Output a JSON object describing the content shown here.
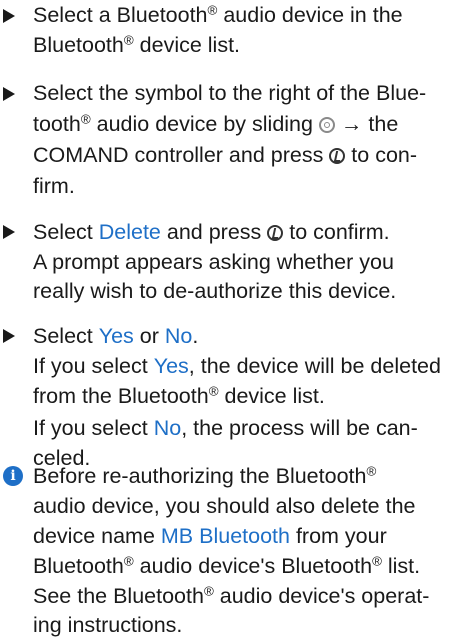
{
  "steps": [
    {
      "lines": [
        [
          "Select a Bluetooth",
          "®",
          " audio device in the"
        ],
        [
          "Bluetooth",
          "®",
          " device list."
        ]
      ]
    },
    {
      "lines": [
        [
          "Select the symbol to the right of the Blue-"
        ],
        [
          "tooth",
          "®",
          " audio device by sliding ",
          "controller-icon",
          " → the"
        ],
        [
          "COMAND controller and press ",
          "press-icon",
          " to con-"
        ],
        [
          "firm."
        ]
      ]
    },
    {
      "lines": [
        [
          "Select ",
          "Delete",
          " and press ",
          "press-icon",
          " to confirm."
        ],
        [
          "A prompt appears asking whether you"
        ],
        [
          "really wish to de-authorize this device."
        ]
      ]
    },
    {
      "lines": [
        [
          "Select ",
          "Yes",
          " or ",
          "No",
          "."
        ],
        [
          "If you select ",
          "Yes",
          ", the device will be deleted"
        ],
        [
          "from the Bluetooth",
          "®",
          " device list."
        ],
        [
          "If you select ",
          "No",
          ", the process will be can-"
        ],
        [
          "celed."
        ]
      ]
    }
  ],
  "note": {
    "lines": [
      [
        "Before re-authorizing the Bluetooth",
        "®"
      ],
      [
        "audio device, you should also delete the"
      ],
      [
        "device name ",
        "MB Bluetooth",
        " from your"
      ],
      [
        "Bluetooth",
        "®",
        " audio device's Bluetooth",
        "®",
        " list."
      ],
      [
        "See the Bluetooth",
        "®",
        " audio device's operat-"
      ],
      [
        "ing instructions."
      ]
    ]
  },
  "text": {
    "s1a": "Select a Bluetooth",
    "s1b": " audio device in the",
    "s1c": "Bluetooth",
    "s1d": " device list.",
    "s2a": "Select the symbol to the right of the Blue-",
    "s2b": "tooth",
    "s2c": " audio device by sliding ",
    "s2d": " → the",
    "s2e": "COMAND controller and press ",
    "s2f": " to con-",
    "s2g": "firm.",
    "s3a": "Select ",
    "s3b": "Delete",
    "s3c": " and press ",
    "s3d": " to confirm.",
    "s3e": "A prompt appears asking whether you",
    "s3f": "really wish to de-authorize this device.",
    "s4a": "Select ",
    "s4b": "Yes",
    "s4c": " or ",
    "s4d": "No",
    "s4e": ".",
    "s4f": "If you select ",
    "s4g": "Yes",
    "s4h": ", the device will be deleted",
    "s4i": "from the Bluetooth",
    "s4j": " device list.",
    "s4k": "If you select ",
    "s4l": "No",
    "s4m": ", the process will be can-",
    "s4n": "celed.",
    "n1": "Before re-authorizing the Bluetooth",
    "n2": "audio device, you should also delete the",
    "n3a": "device name ",
    "n3b": "MB Bluetooth",
    "n3c": " from your",
    "n4a": "Bluetooth",
    "n4b": " audio device's Bluetooth",
    "n4c": " list.",
    "n5a": "See the Bluetooth",
    "n5b": " audio device's operat-",
    "n6": "ing instructions.",
    "reg": "®",
    "info_glyph": "i"
  },
  "colors": {
    "accent": "#1e6fc7",
    "text": "#1a1a1a"
  },
  "icons": [
    "step-arrow-icon",
    "controller-slide-icon",
    "controller-press-icon",
    "info-icon"
  ]
}
